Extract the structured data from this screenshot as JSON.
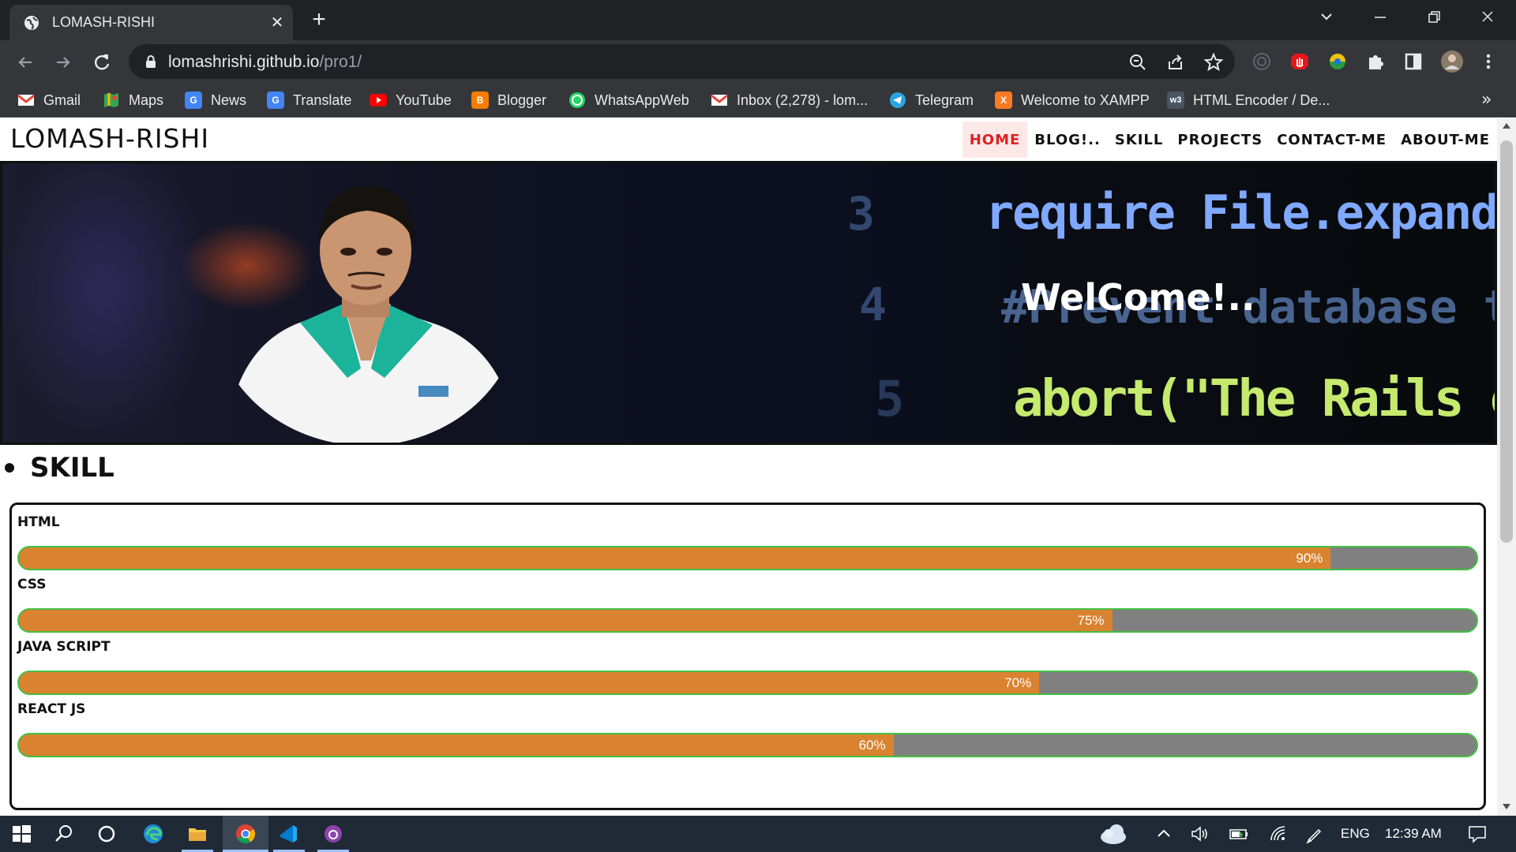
{
  "browser": {
    "tab_title": "LOMASH-RISHI",
    "url_host": "lomashrishi.github.io",
    "url_path": "/pro1/",
    "bookmarks": [
      {
        "label": "Gmail",
        "icon": "gmail-icon",
        "color": "#ea4335"
      },
      {
        "label": "Maps",
        "icon": "maps-icon",
        "color": "#34a853"
      },
      {
        "label": "News",
        "icon": "news-icon",
        "color": "#4285f4"
      },
      {
        "label": "Translate",
        "icon": "translate-icon",
        "color": "#4285f4"
      },
      {
        "label": "YouTube",
        "icon": "youtube-icon",
        "color": "#ff0000"
      },
      {
        "label": "Blogger",
        "icon": "blogger-icon",
        "color": "#f57d00"
      },
      {
        "label": "WhatsAppWeb",
        "icon": "whatsapp-icon",
        "color": "#25d366"
      },
      {
        "label": "Inbox (2,278) - lom...",
        "icon": "gmail-icon",
        "color": "#ea4335"
      },
      {
        "label": "Telegram",
        "icon": "telegram-icon",
        "color": "#2aa3e1"
      },
      {
        "label": "Welcome to XAMPP",
        "icon": "xampp-icon",
        "color": "#fb7a24"
      },
      {
        "label": "HTML Encoder / De...",
        "icon": "w3-icon",
        "color": "#3a4654"
      }
    ]
  },
  "site": {
    "logo": "LOMASH-RISHI",
    "nav": [
      {
        "label": "HOME",
        "active": true
      },
      {
        "label": "BLOG!..",
        "active": false
      },
      {
        "label": "SKILL",
        "active": false
      },
      {
        "label": "PROJECTS",
        "active": false
      },
      {
        "label": "CONTACT-ME",
        "active": false
      },
      {
        "label": "ABOUT-ME",
        "active": false
      }
    ],
    "hero": {
      "welcome": "WelCome!..",
      "line_numbers": [
        "3",
        "4",
        "5"
      ],
      "code_lines": [
        "require File.expand_p",
        "#Prevent database t",
        "abort(\"The Rails env"
      ]
    },
    "skill_heading": "SKILL",
    "skills": [
      {
        "name": "HTML",
        "percent": 90,
        "label": "90%"
      },
      {
        "name": "CSS",
        "percent": 75,
        "label": "75%"
      },
      {
        "name": "JAVA SCRIPT",
        "percent": 70,
        "label": "70%"
      },
      {
        "name": "REACT JS",
        "percent": 60,
        "label": "60%"
      }
    ]
  },
  "taskbar": {
    "language": "ENG",
    "time": "12:39 AM"
  },
  "colors": {
    "accent_red": "#e02020",
    "bar_fill": "#d98330",
    "bar_track": "#808080",
    "bar_border": "#43c043"
  }
}
